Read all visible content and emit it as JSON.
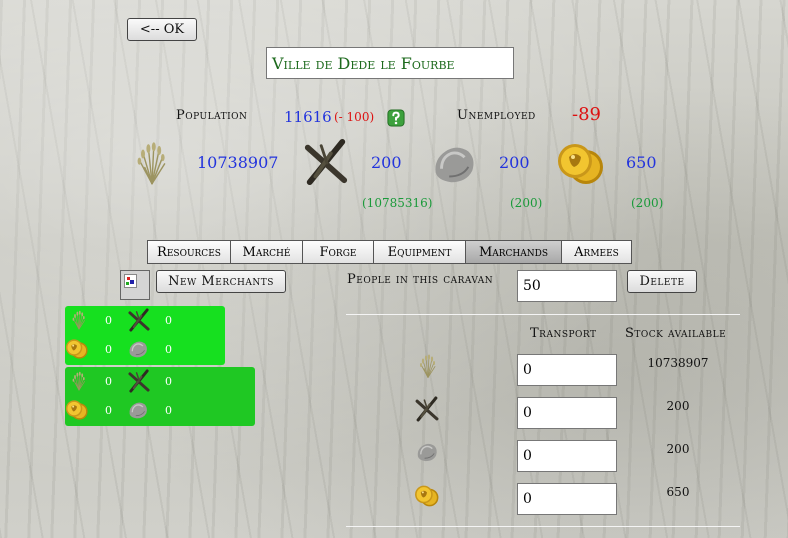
{
  "header": {
    "back_label": "<-- OK",
    "city_name": "Ville de Dede le Fourbe"
  },
  "population": {
    "label": "Population",
    "value": "11616",
    "delta": "(- 100)",
    "unemployed_label": "Unemployed",
    "unemployed_value": "-89"
  },
  "resources": {
    "wheat": {
      "value": "10738907"
    },
    "wood": {
      "value": "200",
      "sub": "(10785316)"
    },
    "stone": {
      "value": "200",
      "sub": "(200)"
    },
    "gold": {
      "value": "650",
      "sub": "(200)"
    }
  },
  "tabs": [
    {
      "label": "Resources"
    },
    {
      "label": "Marché"
    },
    {
      "label": "Forge"
    },
    {
      "label": "Equipment"
    },
    {
      "label": "Marchands"
    },
    {
      "label": "Armees"
    }
  ],
  "active_tab": "Marchands",
  "merchants_panel": {
    "new_merchants_label": "New Merchants",
    "caravans": [
      {
        "wheat": "0",
        "wood": "0",
        "gold": "0",
        "stone": "0",
        "color": "#16e01f"
      },
      {
        "wheat": "0",
        "wood": "0",
        "gold": "0",
        "stone": "0",
        "color": "#1fc823"
      }
    ]
  },
  "caravan": {
    "people_label": "People in this caravan",
    "people_value": "50",
    "delete_label": "Delete",
    "transport_header": "Transport",
    "stock_header": "Stock available",
    "rows": [
      {
        "icon": "wheat-icon",
        "transport": "0",
        "stock": "10738907"
      },
      {
        "icon": "wood-icon",
        "transport": "0",
        "stock": "200"
      },
      {
        "icon": "stone-icon",
        "transport": "0",
        "stock": "200"
      },
      {
        "icon": "gold-icon",
        "transport": "0",
        "stock": "650"
      }
    ]
  },
  "colors": {
    "value_blue": "#2233dd",
    "sub_green": "#1a9a3a",
    "warn_red": "#dd1111",
    "title_green": "#1d6a1d"
  }
}
